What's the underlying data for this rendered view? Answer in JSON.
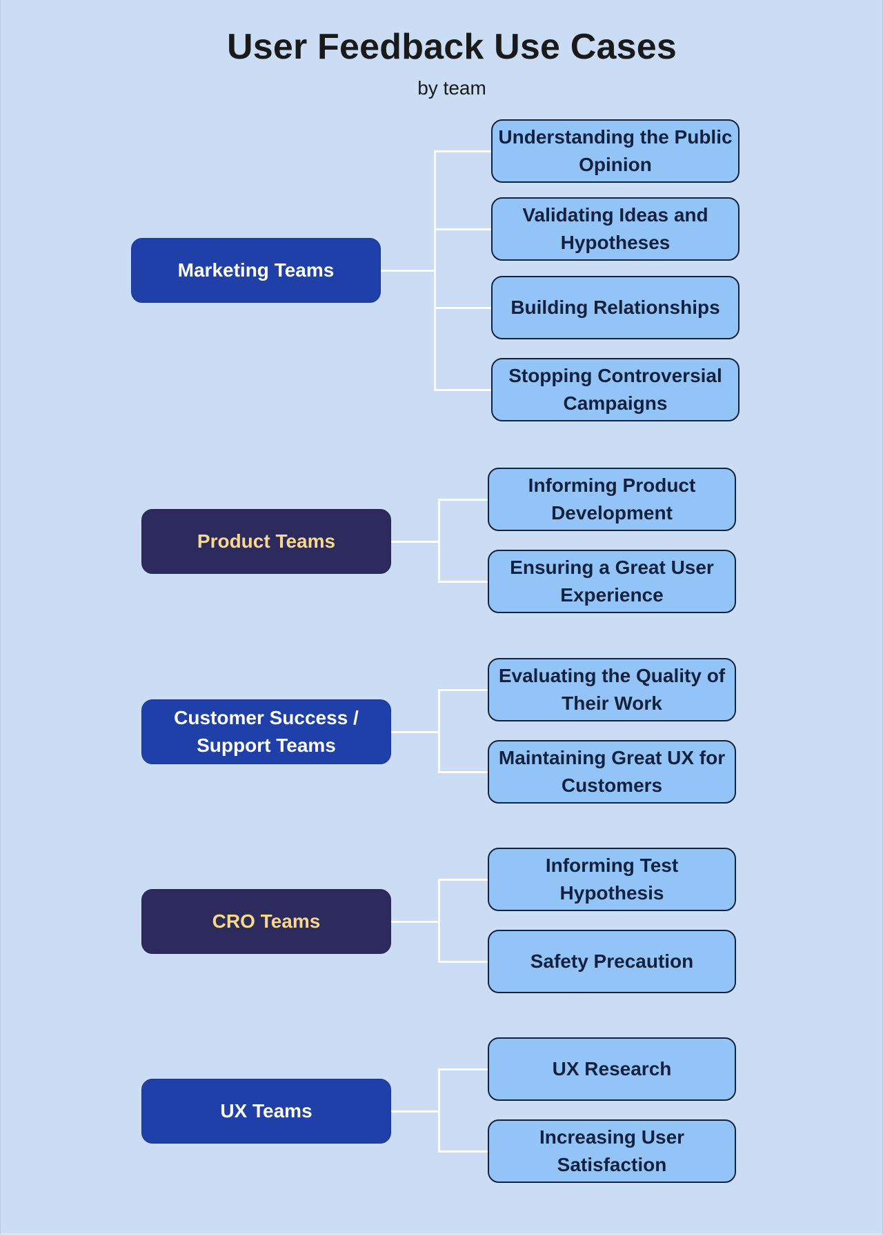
{
  "title": "User Feedback Use Cases",
  "subtitle": "by team",
  "colors": {
    "background": "#cbdcf5",
    "team_blue": "#1f40a8",
    "team_dark": "#2d2a5e",
    "team_dark_text": "#f8d88a",
    "usecase_fill": "#93c4f8",
    "usecase_border": "#14213d",
    "connector": "#ffffff"
  },
  "groups": [
    {
      "team": "Marketing Teams",
      "style": "blue",
      "use_cases": [
        "Understanding the Public Opinion",
        "Validating Ideas and Hypotheses",
        "Building Relationships",
        "Stopping Controversial Campaigns"
      ]
    },
    {
      "team": "Product Teams",
      "style": "dark",
      "use_cases": [
        "Informing Product Development",
        "Ensuring a Great User Experience"
      ]
    },
    {
      "team": "Customer Success / Support Teams",
      "style": "blue",
      "use_cases": [
        "Evaluating the Quality of Their Work",
        "Maintaining Great UX for Customers"
      ]
    },
    {
      "team": "CRO Teams",
      "style": "dark",
      "use_cases": [
        "Informing Test Hypothesis",
        "Safety Precaution"
      ]
    },
    {
      "team": "UX Teams",
      "style": "blue",
      "use_cases": [
        "UX Research",
        "Increasing User Satisfaction"
      ]
    }
  ]
}
